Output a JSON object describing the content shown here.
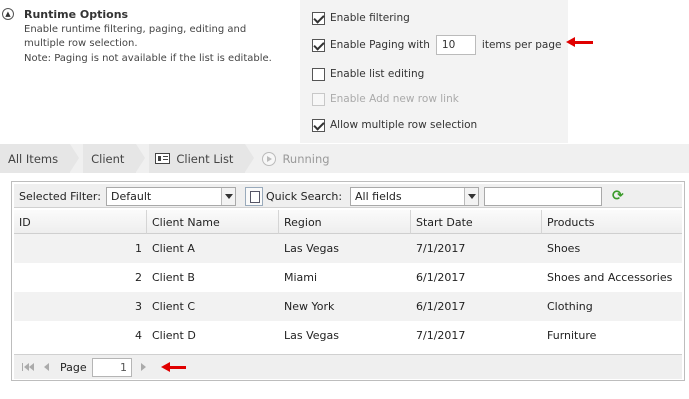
{
  "runtime_options": {
    "title": "Runtime Options",
    "description_lines": [
      "Enable runtime filtering, paging, editing and",
      "multiple row selection.",
      "Note: Paging is not available if the list is editable."
    ]
  },
  "settings": {
    "enable_filtering": {
      "label": "Enable filtering",
      "checked": true
    },
    "enable_paging": {
      "label": "Enable Paging with",
      "checked": true,
      "page_size": "10",
      "suffix": "items per page"
    },
    "enable_list_editing": {
      "label": "Enable list editing",
      "checked": false
    },
    "enable_add_new_row": {
      "label": "Enable Add new row link",
      "checked": false,
      "disabled": true
    },
    "allow_multiple_selection": {
      "label": "Allow multiple row selection",
      "checked": true
    }
  },
  "breadcrumb": {
    "items": [
      "All Items",
      "Client",
      "Client List",
      "Running"
    ]
  },
  "toolbar": {
    "selected_filter_label": "Selected Filter:",
    "selected_filter_value": "Default",
    "quick_search_label": "Quick Search:",
    "quick_search_scope": "All fields",
    "search_value": ""
  },
  "table": {
    "columns": [
      "ID",
      "Client Name",
      "Region",
      "Start Date",
      "Products"
    ],
    "rows": [
      {
        "id": "1",
        "client": "Client A",
        "region": "Las Vegas",
        "start": "7/1/2017",
        "products": "Shoes"
      },
      {
        "id": "2",
        "client": "Client B",
        "region": "Miami",
        "start": "6/1/2017",
        "products": "Shoes and Accessories"
      },
      {
        "id": "3",
        "client": "Client C",
        "region": "New York",
        "start": "6/1/2017",
        "products": "Clothing"
      },
      {
        "id": "4",
        "client": "Client D",
        "region": "Las Vegas",
        "start": "7/1/2017",
        "products": "Furniture"
      }
    ]
  },
  "pager": {
    "page_label": "Page",
    "page_value": "1"
  },
  "colors": {
    "annotation_arrow": "#e00000",
    "refresh_icon": "#3a9b2a"
  }
}
